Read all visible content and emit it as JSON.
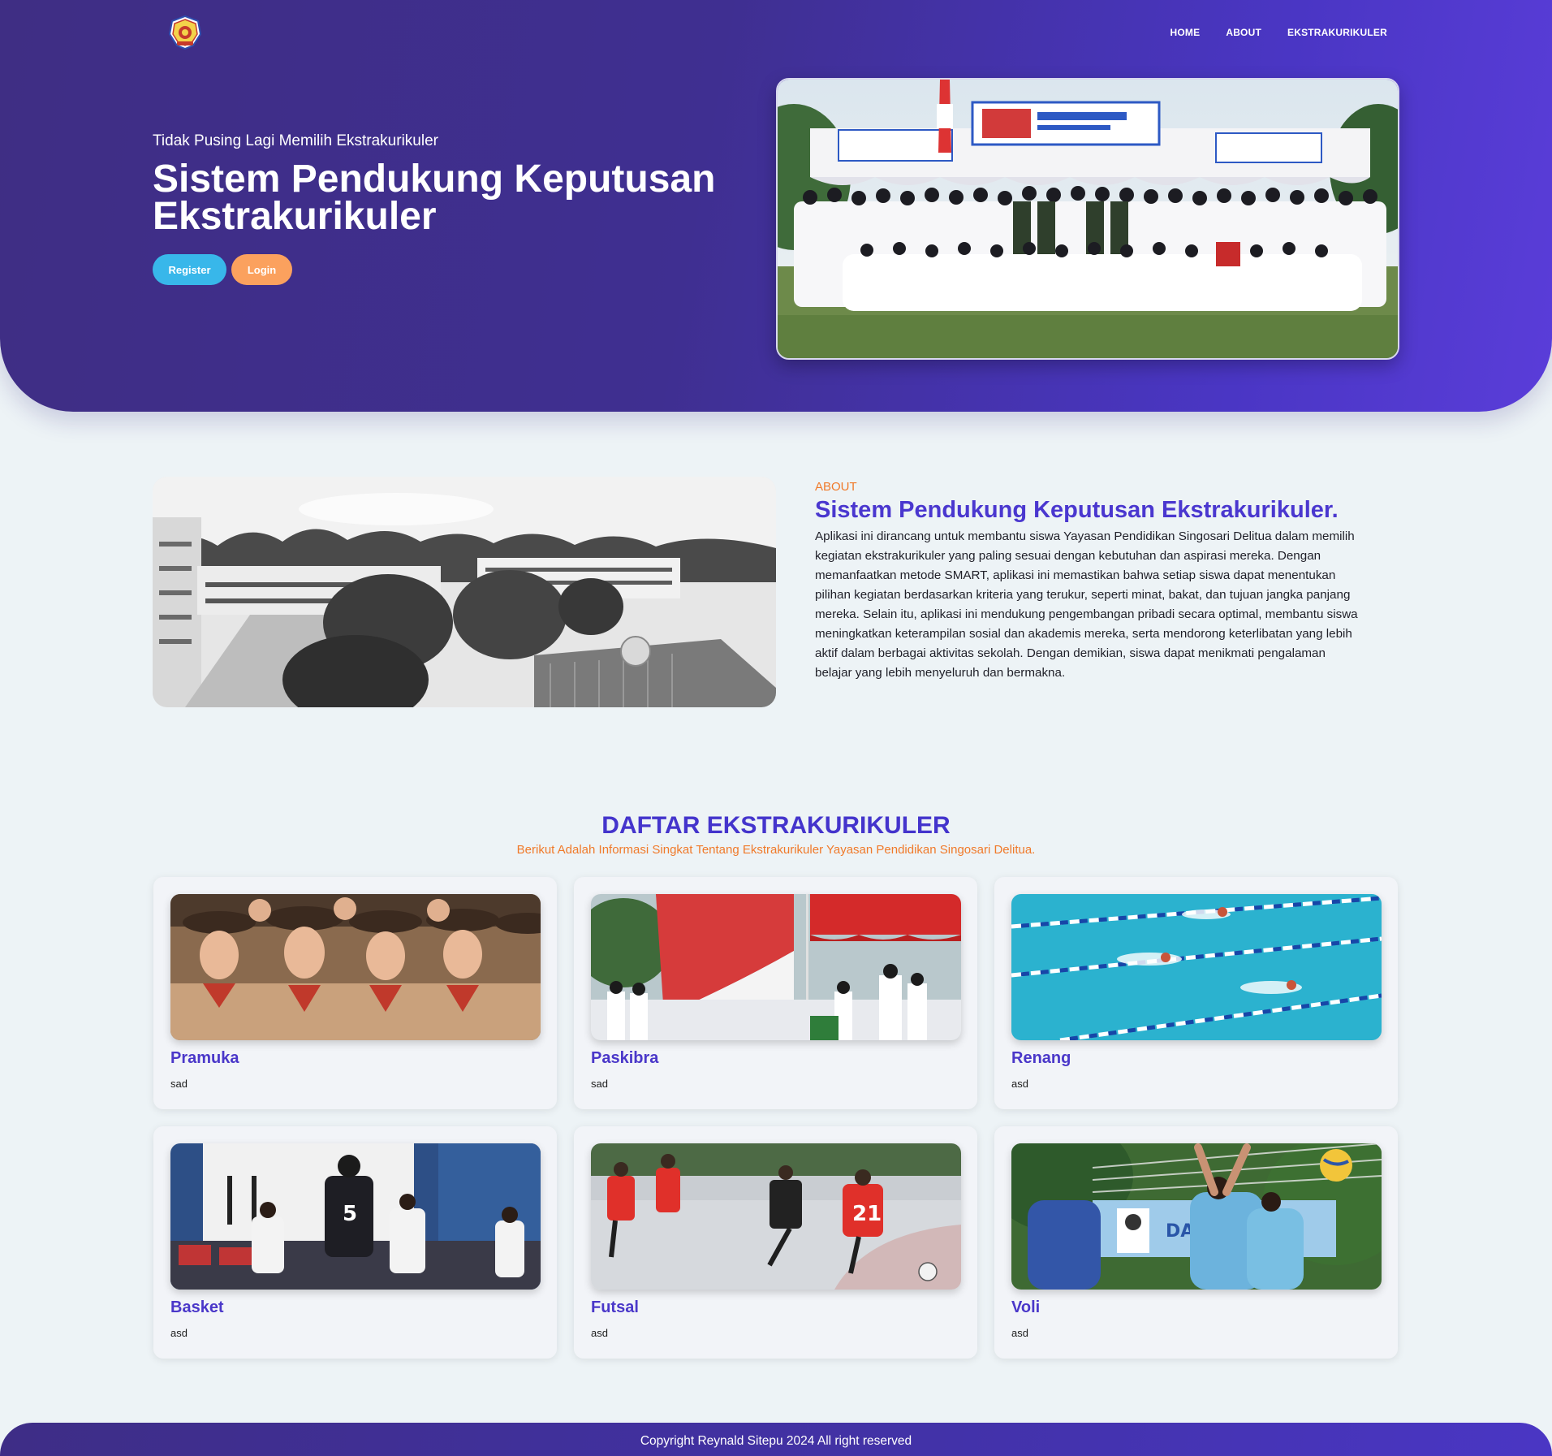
{
  "nav": {
    "logo_alt": "school-crest",
    "items": [
      {
        "label": "HOME"
      },
      {
        "label": "ABOUT"
      },
      {
        "label": "EKSTRAKURIKULER"
      }
    ]
  },
  "hero": {
    "subtitle": "Tidak Pusing Lagi Memilih Ekstrakurikuler",
    "title_line1": "Sistem Pendukung Keputusan",
    "title_line2": "Ekstrakurikuler",
    "register_label": "Register",
    "login_label": "Login",
    "photo": "paskibra-group-photo"
  },
  "about": {
    "label": "ABOUT",
    "title": "Sistem Pendukung Keputusan Ekstrakurikuler.",
    "text": "Aplikasi ini dirancang untuk membantu siswa Yayasan Pendidikan Singosari Delitua dalam memilih kegiatan ekstrakurikuler yang paling sesuai dengan kebutuhan dan aspirasi mereka. Dengan memanfaatkan metode SMART, aplikasi ini memastikan bahwa setiap siswa dapat menentukan pilihan kegiatan berdasarkan kriteria yang terukur, seperti minat, bakat, dan tujuan jangka panjang mereka. Selain itu, aplikasi ini mendukung pengembangan pribadi secara optimal, membantu siswa meningkatkan keterampilan sosial dan akademis mereka, serta mendorong keterlibatan yang lebih aktif dalam berbagai aktivitas sekolah. Dengan demikian, siswa dapat menikmati pengalaman belajar yang lebih menyeluruh dan bermakna.",
    "photo": "school-campus-aerial-bw"
  },
  "list": {
    "title": "DAFTAR EKSTRAKURIKULER",
    "subtitle": "Berikut Adalah Informasi Singkat Tentang Ekstrakurikuler Yayasan Pendidikan Singosari Delitua.",
    "cards": [
      {
        "name": "Pramuka",
        "desc": "sad",
        "image": "scouts-photo"
      },
      {
        "name": "Paskibra",
        "desc": "sad",
        "image": "flag-raising-photo"
      },
      {
        "name": "Renang",
        "desc": "asd",
        "image": "swimming-pool-photo"
      },
      {
        "name": "Basket",
        "desc": "asd",
        "image": "basketball-photo"
      },
      {
        "name": "Futsal",
        "desc": "asd",
        "image": "futsal-photo"
      },
      {
        "name": "Voli",
        "desc": "asd",
        "image": "volleyball-photo"
      }
    ]
  },
  "footer": {
    "text": "Copyright Reynald Sitepu 2024 All right reserved"
  },
  "colors": {
    "hero_start": "#3f2e84",
    "hero_end": "#5a3dd9",
    "accent_blue": "#38b7ea",
    "accent_orange": "#fba15e",
    "title_purple": "#4a37cf",
    "label_orange": "#f07a2a",
    "page_bg": "#edf3f6"
  }
}
